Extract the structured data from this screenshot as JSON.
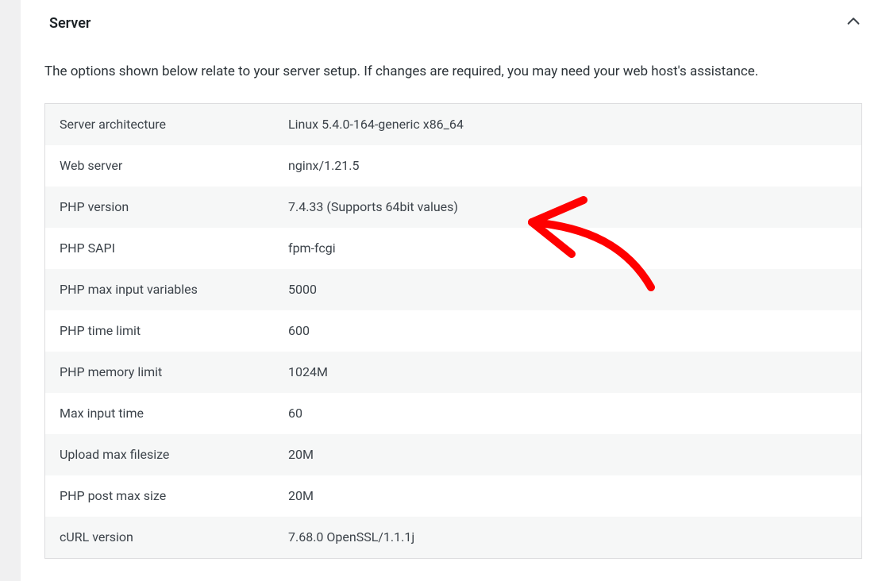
{
  "panel": {
    "title": "Server",
    "description": "The options shown below relate to your server setup. If changes are required, you may need your web host's assistance.",
    "rows": [
      {
        "label": "Server architecture",
        "value": "Linux 5.4.0-164-generic x86_64"
      },
      {
        "label": "Web server",
        "value": "nginx/1.21.5"
      },
      {
        "label": "PHP version",
        "value": "7.4.33 (Supports 64bit values)"
      },
      {
        "label": "PHP SAPI",
        "value": "fpm-fcgi"
      },
      {
        "label": "PHP max input variables",
        "value": "5000"
      },
      {
        "label": "PHP time limit",
        "value": "600"
      },
      {
        "label": "PHP memory limit",
        "value": "1024M"
      },
      {
        "label": "Max input time",
        "value": "60"
      },
      {
        "label": "Upload max filesize",
        "value": "20M"
      },
      {
        "label": "PHP post max size",
        "value": "20M"
      },
      {
        "label": "cURL version",
        "value": "7.68.0 OpenSSL/1.1.1j"
      }
    ]
  },
  "annotation": {
    "type": "hand-drawn-arrow",
    "color": "#ff0000"
  }
}
